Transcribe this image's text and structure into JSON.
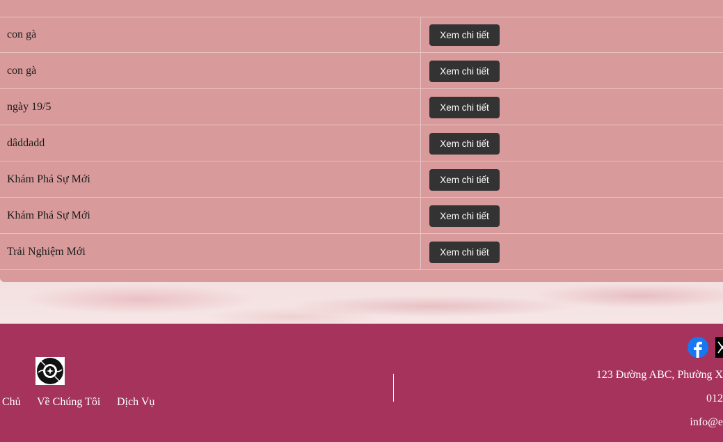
{
  "table": {
    "heading": "",
    "rows": [
      {
        "name": "con gà",
        "action": "Xem chi tiết"
      },
      {
        "name": "con gà",
        "action": "Xem chi tiết"
      },
      {
        "name": "ngày 19/5",
        "action": "Xem chi tiết"
      },
      {
        "name": "dâddadd",
        "action": "Xem chi tiết"
      },
      {
        "name": "Khám Phá Sự Mới",
        "action": "Xem chi tiết"
      },
      {
        "name": "Khám Phá Sự Mới",
        "action": "Xem chi tiết"
      },
      {
        "name": "Trải Nghiệm Mới",
        "action": "Xem chi tiết"
      }
    ]
  },
  "footer": {
    "nav": [
      "Chủ",
      "Về Chúng Tôi",
      "Dịch Vụ"
    ],
    "address": "123 Đường ABC, Phường X",
    "phone": "012",
    "email": "info@e",
    "social": [
      "facebook-icon",
      "x-twitter-icon"
    ]
  },
  "colors": {
    "panel": "#d89a9a",
    "button": "#333333",
    "footer": "#a5335c"
  }
}
